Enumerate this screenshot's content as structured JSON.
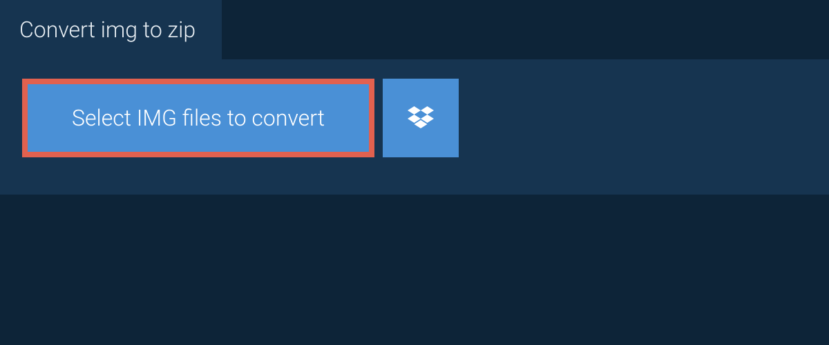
{
  "tab": {
    "label": "Convert img to zip"
  },
  "actions": {
    "select_files_label": "Select IMG files to convert"
  }
}
